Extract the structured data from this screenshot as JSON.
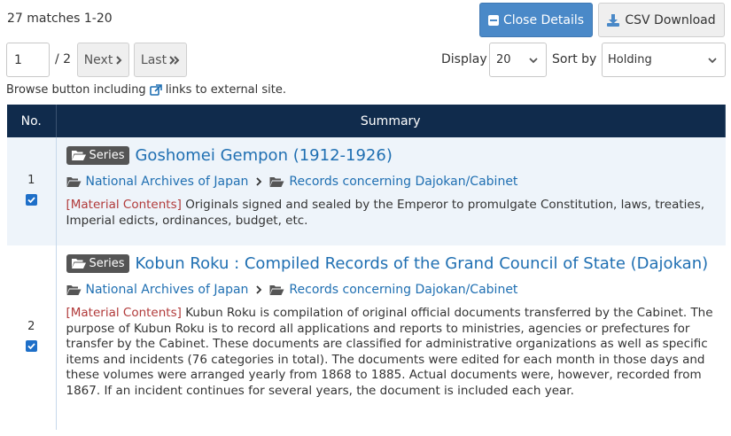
{
  "header": {
    "matches": "27 matches 1-20",
    "close_details_label": "Close Details",
    "csv_download_label": "CSV Download"
  },
  "pager": {
    "page_value": "1",
    "total": "/ 2",
    "next_label": "Next",
    "last_label": "Last"
  },
  "display": {
    "label": "Display",
    "value": "20"
  },
  "sort": {
    "label": "Sort by",
    "value": "Holding"
  },
  "browse_note": {
    "prefix": "Browse button including",
    "suffix": "links to external site."
  },
  "table": {
    "col_no": "No.",
    "col_summary": "Summary",
    "rows": [
      {
        "no": "1",
        "badge": "Series",
        "title": "Goshomei Gempon (1912-1926)",
        "crumb1": "National Archives of Japan",
        "crumb2": "Records concerning Dajokan/Cabinet",
        "mc_label": "[Material Contents]",
        "description": "Originals signed and sealed by the Emperor to promulgate Constitution, laws, treaties, Imperial edicts, ordinances, budget, etc.",
        "checked": true
      },
      {
        "no": "2",
        "badge": "Series",
        "title": "Kobun Roku : Compiled Records of the Grand Council of State (Dajokan)",
        "crumb1": "National Archives of Japan",
        "crumb2": "Records concerning Dajokan/Cabinet",
        "mc_label": "[Material Contents]",
        "description": "Kubun Roku is compilation of original official documents transferred by the Cabinet. The purpose of Kubun Roku is to record all applications and reports to ministries, agencies or prefectures for transfer by the Cabinet. These documents are classified for administrative organizations as well as specific items and incidents (76 categories in total). The documents were edited for each month in those days and these volumes were arranged yearly from 1868 to 1885. Actual documents were, however, recorded from 1867. If an incident continues for several years, the document is included each year.",
        "checked": true
      }
    ]
  },
  "colors": {
    "primary_button": "#4a89c8",
    "table_header": "#102b4c",
    "link": "#1f6fb2",
    "material_label": "#b13a3a",
    "row_alt": "#eef4fa"
  }
}
